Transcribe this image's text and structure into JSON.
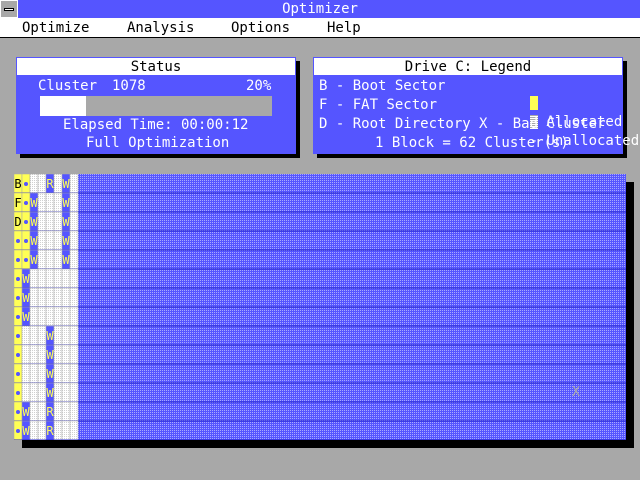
{
  "window": {
    "title": "Optimizer"
  },
  "menu": [
    {
      "label": "Optimize"
    },
    {
      "label": "Analysis"
    },
    {
      "label": "Options"
    },
    {
      "label": "Help"
    }
  ],
  "status": {
    "title": "Status",
    "cluster_label": "Cluster",
    "cluster_value": "1078",
    "percent": "20%",
    "progress_fraction": 0.2,
    "elapsed": "Elapsed Time: 00:00:12",
    "mode": "Full Optimization"
  },
  "legend": {
    "title": "Drive C: Legend",
    "items": [
      "B - Boot Sector",
      "F - FAT Sector",
      "D - Root Directory",
      "- Allocated",
      "- Unallocated",
      "X - Bad Cluster"
    ],
    "block_size": "1 Block = 62 Cluster(s)"
  },
  "drive_map": {
    "rows": [
      "B.  R W",
      "F.W   W",
      "D.W   W",
      "..W   W",
      "..W   W",
      ".W     ",
      ".W     ",
      ".W     ",
      ".   W  ",
      ".   W  ",
      ".   W  ",
      ".   W  ",
      ".W  R  ",
      ".W  R  "
    ],
    "bad_cluster": "X",
    "colors": {
      "allocated": "#ffff55",
      "unallocated": "#5555ff",
      "written": "#5555ff",
      "free_light": "#ffffff",
      "letters": "#000000"
    }
  }
}
